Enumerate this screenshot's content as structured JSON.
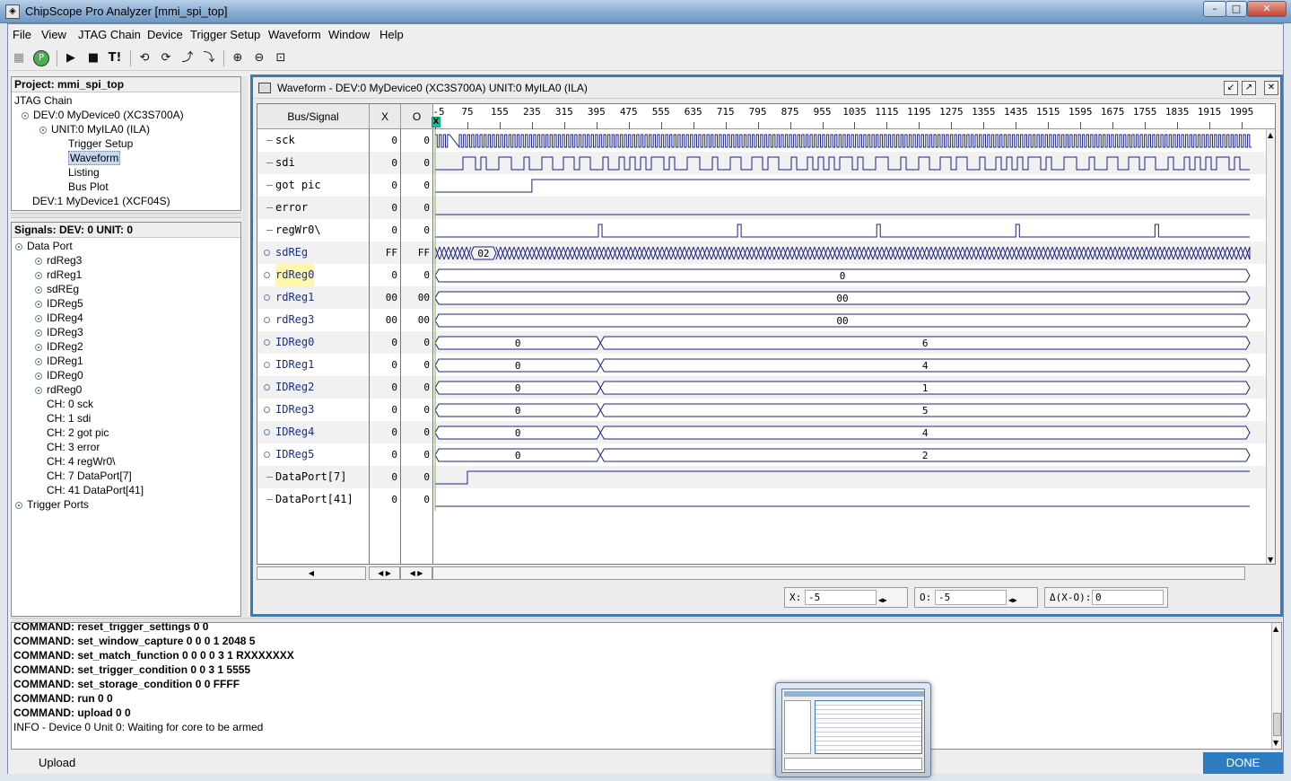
{
  "window": {
    "title": "ChipScope Pro Analyzer [mmi_spi_top]",
    "minimize": "–",
    "maximize": "□",
    "close": "✕"
  },
  "menu": [
    "File",
    "View",
    "JTAG Chain",
    "Device",
    "Trigger Setup",
    "Waveform",
    "Window",
    "Help"
  ],
  "toolbar": {
    "icons": [
      "grid-icon",
      "play-circle-icon",
      "run-icon",
      "stop-icon",
      "trigger-immediate-icon",
      "nav-prev-icon",
      "nav-next-icon",
      "nav-up-icon",
      "nav-down-icon",
      "zoom-in-icon",
      "zoom-out-icon",
      "zoom-fit-icon"
    ],
    "trigger_immediate_label": "T!"
  },
  "project": {
    "header": "Project: mmi_spi_top",
    "items": [
      {
        "label": "JTAG Chain",
        "indent": 0,
        "knob": false
      },
      {
        "label": "DEV:0 MyDevice0 (XC3S700A)",
        "indent": 1,
        "knob": true
      },
      {
        "label": "UNIT:0 MyILA0 (ILA)",
        "indent": 2,
        "knob": true
      },
      {
        "label": "Trigger Setup",
        "indent": 3,
        "knob": false
      },
      {
        "label": "Waveform",
        "indent": 3,
        "knob": false,
        "selected": true
      },
      {
        "label": "Listing",
        "indent": 3,
        "knob": false
      },
      {
        "label": "Bus Plot",
        "indent": 3,
        "knob": false
      },
      {
        "label": "DEV:1 MyDevice1 (XCF04S)",
        "indent": 1,
        "knob": false
      }
    ]
  },
  "signals_panel": {
    "header": "Signals: DEV: 0 UNIT: 0",
    "items": [
      {
        "label": "Data Port",
        "indent": 0,
        "knob": true
      },
      {
        "label": "rdReg3",
        "indent": 1,
        "knob": true
      },
      {
        "label": "rdReg1",
        "indent": 1,
        "knob": true
      },
      {
        "label": "sdREg",
        "indent": 1,
        "knob": true
      },
      {
        "label": "IDReg5",
        "indent": 1,
        "knob": true
      },
      {
        "label": "IDReg4",
        "indent": 1,
        "knob": true
      },
      {
        "label": "IDReg3",
        "indent": 1,
        "knob": true
      },
      {
        "label": "IDReg2",
        "indent": 1,
        "knob": true
      },
      {
        "label": "IDReg1",
        "indent": 1,
        "knob": true
      },
      {
        "label": "IDReg0",
        "indent": 1,
        "knob": true
      },
      {
        "label": "rdReg0",
        "indent": 1,
        "knob": true
      },
      {
        "label": "CH: 0 sck",
        "indent": 1,
        "knob": false
      },
      {
        "label": "CH: 1 sdi",
        "indent": 1,
        "knob": false
      },
      {
        "label": "CH: 2 got pic",
        "indent": 1,
        "knob": false
      },
      {
        "label": "CH: 3 error",
        "indent": 1,
        "knob": false
      },
      {
        "label": "CH: 4 regWr0\\",
        "indent": 1,
        "knob": false
      },
      {
        "label": "CH: 7 DataPort[7]",
        "indent": 1,
        "knob": false
      },
      {
        "label": "CH: 41 DataPort[41]",
        "indent": 1,
        "knob": false
      },
      {
        "label": "Trigger Ports",
        "indent": 0,
        "knob": true
      }
    ]
  },
  "waveform": {
    "title": "Waveform - DEV:0 MyDevice0 (XC3S700A) UNIT:0 MyILA0 (ILA)",
    "col_bus_signal": "Bus/Signal",
    "col_x": "X",
    "col_o": "O",
    "ruler_ticks": [
      "-5",
      "75",
      "155",
      "235",
      "315",
      "395",
      "475",
      "555",
      "635",
      "715",
      "795",
      "875",
      "955",
      "1035",
      "1115",
      "1195",
      "1275",
      "1355",
      "1435",
      "1515",
      "1595",
      "1675",
      "1755",
      "1835",
      "1915",
      "1995"
    ],
    "cursor_marker": "X",
    "rows": [
      {
        "name": "sck",
        "bus": false,
        "x": "0",
        "o": "0",
        "kind": "clock"
      },
      {
        "name": "sdi",
        "bus": false,
        "x": "0",
        "o": "0",
        "kind": "data"
      },
      {
        "name": "got pic",
        "bus": false,
        "x": "0",
        "o": "0",
        "kind": "step",
        "step_at": 235
      },
      {
        "name": "error",
        "bus": false,
        "x": "0",
        "o": "0",
        "kind": "low"
      },
      {
        "name": "regWr0\\",
        "bus": false,
        "x": "0",
        "o": "0",
        "kind": "pulses",
        "pulses": [
          400,
          745,
          1090,
          1435,
          1780
        ]
      },
      {
        "name": "sdREg",
        "bus": true,
        "x": "FF",
        "o": "FF",
        "kind": "busdense",
        "label": "02",
        "label_at": 115
      },
      {
        "name": "rdReg0",
        "bus": true,
        "x": "0",
        "o": "0",
        "kind": "bus",
        "segments": [
          {
            "from": -5,
            "to": 2015,
            "label": "0"
          }
        ],
        "highlight": true
      },
      {
        "name": "rdReg1",
        "bus": true,
        "x": "00",
        "o": "00",
        "kind": "bus",
        "segments": [
          {
            "from": -5,
            "to": 2015,
            "label": "00"
          }
        ]
      },
      {
        "name": "rdReg3",
        "bus": true,
        "x": "00",
        "o": "00",
        "kind": "bus",
        "segments": [
          {
            "from": -5,
            "to": 2015,
            "label": "00"
          }
        ]
      },
      {
        "name": "IDReg0",
        "bus": true,
        "x": "0",
        "o": "0",
        "kind": "bus",
        "segments": [
          {
            "from": -5,
            "to": 405,
            "label": "0"
          },
          {
            "from": 405,
            "to": 2015,
            "label": "6"
          }
        ]
      },
      {
        "name": "IDReg1",
        "bus": true,
        "x": "0",
        "o": "0",
        "kind": "bus",
        "segments": [
          {
            "from": -5,
            "to": 405,
            "label": "0"
          },
          {
            "from": 405,
            "to": 2015,
            "label": "4"
          }
        ]
      },
      {
        "name": "IDReg2",
        "bus": true,
        "x": "0",
        "o": "0",
        "kind": "bus",
        "segments": [
          {
            "from": -5,
            "to": 405,
            "label": "0"
          },
          {
            "from": 405,
            "to": 2015,
            "label": "1"
          }
        ]
      },
      {
        "name": "IDReg3",
        "bus": true,
        "x": "0",
        "o": "0",
        "kind": "bus",
        "segments": [
          {
            "from": -5,
            "to": 405,
            "label": "0"
          },
          {
            "from": 405,
            "to": 2015,
            "label": "5"
          }
        ]
      },
      {
        "name": "IDReg4",
        "bus": true,
        "x": "0",
        "o": "0",
        "kind": "bus",
        "segments": [
          {
            "from": -5,
            "to": 405,
            "label": "0"
          },
          {
            "from": 405,
            "to": 2015,
            "label": "4"
          }
        ]
      },
      {
        "name": "IDReg5",
        "bus": true,
        "x": "0",
        "o": "0",
        "kind": "bus",
        "segments": [
          {
            "from": -5,
            "to": 405,
            "label": "0"
          },
          {
            "from": 405,
            "to": 2015,
            "label": "2"
          }
        ]
      },
      {
        "name": "DataPort[7]",
        "bus": false,
        "x": "0",
        "o": "0",
        "kind": "step",
        "step_at": 75
      },
      {
        "name": "DataPort[41]",
        "bus": false,
        "x": "0",
        "o": "0",
        "kind": "low"
      }
    ],
    "cursor_x": {
      "label": "X:",
      "value": "-5"
    },
    "cursor_o": {
      "label": "O:",
      "value": "-5"
    },
    "delta": {
      "label": "Δ(X-O):",
      "value": "0"
    }
  },
  "console": {
    "lines": [
      {
        "prefix": "COMMAND:",
        "text": "reset_trigger_settings 0 0"
      },
      {
        "prefix": "COMMAND:",
        "text": "set_window_capture 0 0 0 1 2048 5"
      },
      {
        "prefix": "COMMAND:",
        "text": "set_match_function 0 0 0 0 3 1 RXXXXXXX"
      },
      {
        "prefix": "COMMAND:",
        "text": "set_trigger_condition 0 0 3 1 5555"
      },
      {
        "prefix": "COMMAND:",
        "text": "set_storage_condition 0 0 FFFF"
      },
      {
        "prefix": "COMMAND:",
        "text": "run 0 0"
      },
      {
        "prefix": "COMMAND:",
        "text": "upload 0 0"
      },
      {
        "prefix": "",
        "text": "INFO - Device 0 Unit 0:  Waiting for core to be armed"
      }
    ]
  },
  "status": {
    "left": "Upload",
    "right": "DONE"
  },
  "colors": {
    "wave": "#1a237e",
    "accent": "#3c78b8",
    "done": "#2d7cc1"
  }
}
